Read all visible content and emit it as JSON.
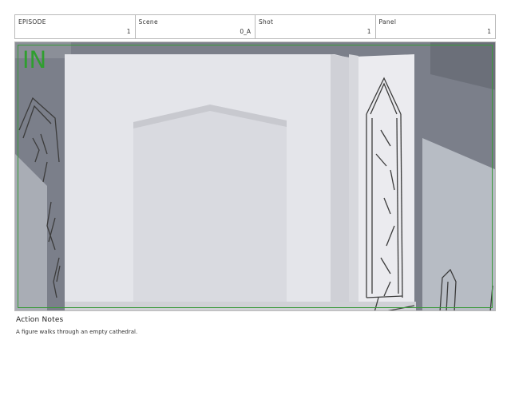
{
  "header": {
    "cells": [
      {
        "label": "EPISODE",
        "value": "1"
      },
      {
        "label": "Scene",
        "value": "0_A"
      },
      {
        "label": "Shot",
        "value": "1"
      },
      {
        "label": "Panel",
        "value": "1"
      }
    ]
  },
  "panel": {
    "marker": "IN",
    "marker_color": "#2f9e2f",
    "frame_border_color": "#3a9a3a"
  },
  "notes": {
    "title": "Action Notes",
    "text": "A figure walks through an empty cathedral."
  }
}
